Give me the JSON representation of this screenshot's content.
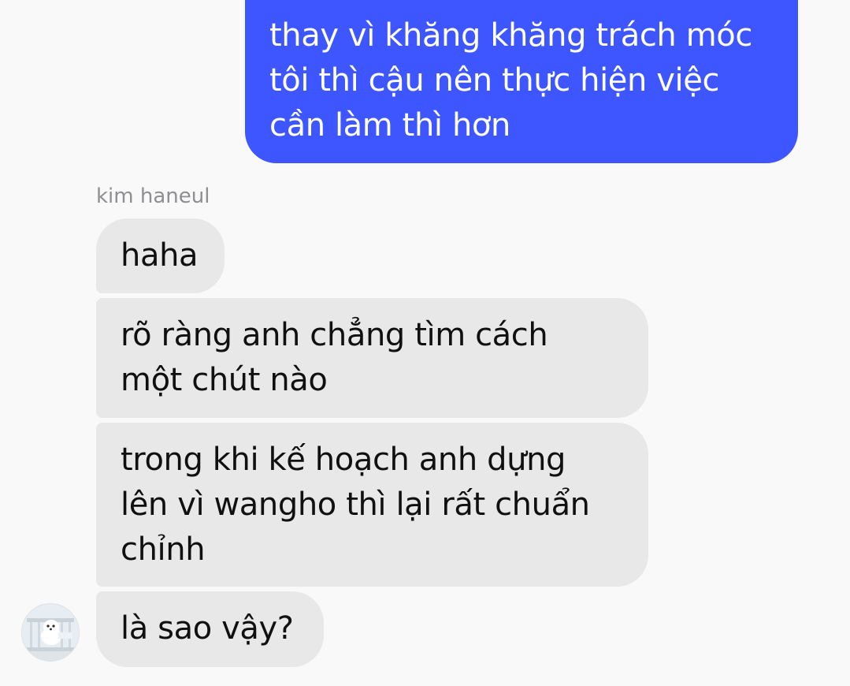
{
  "messages": {
    "outgoing": [
      {
        "text": "thay vì khăng khăng trách móc\ntôi thì cậu nên thực hiện việc\ncần làm thì hơn"
      }
    ],
    "incoming_group": {
      "sender_name": "kim haneul",
      "avatar_icon": "profile-photo-white-dog",
      "bubbles": [
        {
          "text": "haha"
        },
        {
          "text": "rõ ràng anh chẳng tìm cách\nmột chút nào"
        },
        {
          "text": "trong khi kế hoạch anh dựng\nlên vì wangho thì lại rất chuẩn\nchỉnh"
        },
        {
          "text": "là sao vậy?"
        }
      ]
    }
  },
  "colors": {
    "outgoing_bubble": "#3D56FF",
    "incoming_bubble": "#E8E8E8",
    "background": "#F9F9F9",
    "sender_name": "#8E8E93"
  }
}
